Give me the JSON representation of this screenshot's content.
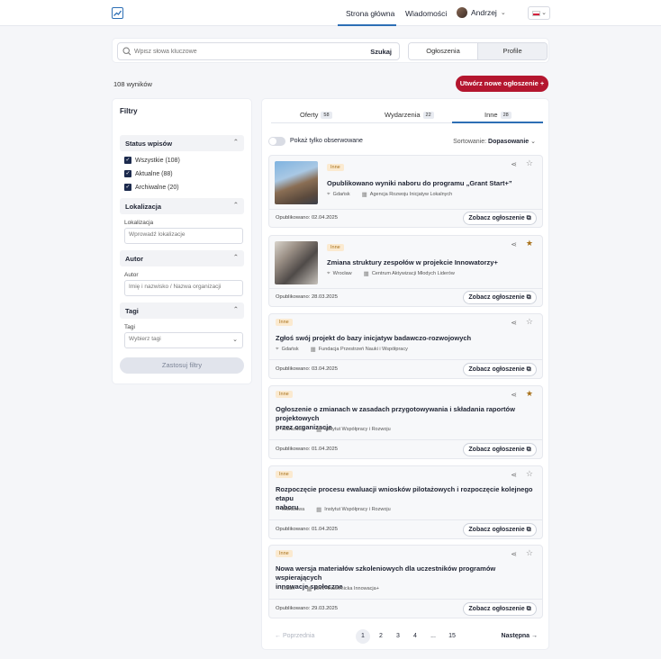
{
  "nav": {
    "home": "Strona główna",
    "messages": "Wiadomości",
    "user": "Andrzej"
  },
  "search": {
    "placeholder": "Wpisz słowa kluczowe",
    "button": "Szukaj",
    "seg_on": "Ogłoszenia",
    "seg_off": "Profile"
  },
  "results_count": "108 wyników",
  "create_button": "Utwórz nowe ogłoszenie  +",
  "filters": {
    "title": "Filtry",
    "status_title": "Status wpisów",
    "statuses": [
      "Wszystkie (108)",
      "Aktualne (88)",
      "Archiwalne (20)"
    ],
    "location_title": "Lokalizacja",
    "location_label": "Lokalizacja",
    "location_placeholder": "Wprowadź lokalizacje",
    "author_title": "Autor",
    "author_label": "Autor",
    "author_placeholder": "Imię i nazwisko / Nazwa organizacji",
    "tags_title": "Tagi",
    "tags_label": "Tagi",
    "tags_placeholder": "Wybierz tagi",
    "apply": "Zastosuj filtry"
  },
  "tabs": [
    {
      "label": "Oferty",
      "count": "58"
    },
    {
      "label": "Wydarzenia",
      "count": "22"
    },
    {
      "label": "Inne",
      "count": "28"
    }
  ],
  "toggle_label": "Pokaż tylko obserwowane",
  "sort": {
    "label": "Sortowanie:",
    "value": "Dopasowanie"
  },
  "accent_color": "#b4162f",
  "cards": [
    {
      "tag": "Inne",
      "title": "Opublikowano wyniki naboru do programu „Grant Start+”",
      "city": "Gdańsk",
      "org": "Agencja Rozwoju Inicjatyw Lokalnych",
      "published": "Opublikowano: 02.04.2025",
      "button": "Zobacz ogłoszenie",
      "starred": false
    },
    {
      "tag": "Inne",
      "title": "Zmiana struktury zespołów w projekcie Innowatorzy+",
      "city": "Wrocław",
      "org": "Centrum Aktywizacji Młodych Liderów",
      "published": "Opublikowano: 28.03.2025",
      "button": "Zobacz ogłoszenie",
      "starred": true
    },
    {
      "tag": "Inne",
      "title": "Zgłoś swój projekt do bazy inicjatyw badawczo-rozwojowych",
      "city": "Gdańsk",
      "org": "Fundacja Przestrzeń Nauki i Współpracy",
      "published": "Opublikowano: 03.04.2025",
      "button": "Zobacz ogłoszenie",
      "starred": false
    },
    {
      "tag": "Inne",
      "title_1": "Ogłoszenie o zmianach w zasadach przygotowywania i składania raportów projektowych",
      "title_2": "przez organizacje",
      "city": "Warszawa",
      "org": "Instytut Współpracy i Rozwoju",
      "published": "Opublikowano: 01.04.2025",
      "button": "Zobacz ogłoszenie",
      "starred": true
    },
    {
      "tag": "Inne",
      "title_1": "Rozpoczęcie procesu ewaluacji wniosków pilotażowych i rozpoczęcie kolejnego etapu",
      "title_2": "naboru",
      "city": "Warszawa",
      "org": "Instytut Współpracy i Rozwoju",
      "published": "Opublikowano: 01.04.2025",
      "button": "Zobacz ogłoszenie",
      "starred": false
    },
    {
      "tag": "Inne",
      "title_1": "Nowa wersja materiałów szkoleniowych dla uczestników programów wspierających",
      "title_2": "innowacje społeczne",
      "city": "Lublin",
      "org": "Sieć Akademicka Innowacja+",
      "published": "Opublikowano: 29.03.2025",
      "button": "Zobacz ogłoszenie",
      "starred": false
    }
  ],
  "pagination": {
    "prev": "← Poprzednia",
    "pages": [
      "1",
      "2",
      "3",
      "4",
      "...",
      "15"
    ],
    "next": "Następna →"
  }
}
